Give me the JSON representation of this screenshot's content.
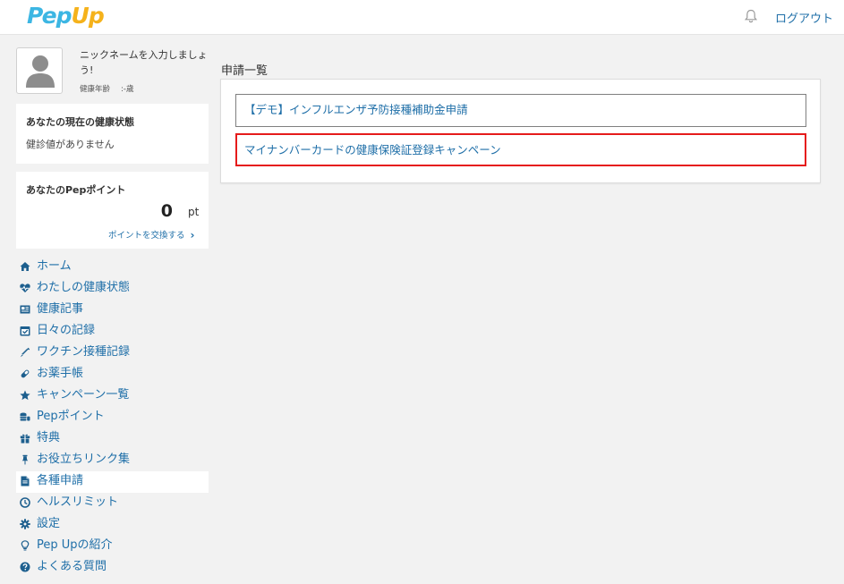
{
  "header": {
    "logo_main": "Pep",
    "logo_accent": "Up",
    "notification_icon": "bell-icon",
    "logout_label": "ログアウト"
  },
  "profile": {
    "nickname_prompt": "ニックネームを入力しましょう!",
    "health_age_label": "健康年齢",
    "health_age_value": ":-歳"
  },
  "health_status": {
    "title": "あなたの現在の健康状態",
    "text": "健診値がありません"
  },
  "points": {
    "title": "あなたのPepポイント",
    "value": "0",
    "unit": "pt",
    "exchange_label": "ポイントを交換する"
  },
  "nav": {
    "items": [
      {
        "label": "ホーム",
        "icon": "home-icon"
      },
      {
        "label": "わたしの健康状態",
        "icon": "heartbeat-icon"
      },
      {
        "label": "健康記事",
        "icon": "newspaper-icon"
      },
      {
        "label": "日々の記録",
        "icon": "calendar-icon"
      },
      {
        "label": "ワクチン接種記録",
        "icon": "syringe-icon"
      },
      {
        "label": "お薬手帳",
        "icon": "pill-icon"
      },
      {
        "label": "キャンペーン一覧",
        "icon": "star-icon"
      },
      {
        "label": "Pepポイント",
        "icon": "coins-icon"
      },
      {
        "label": "特典",
        "icon": "gift-icon"
      },
      {
        "label": "お役立ちリンク集",
        "icon": "pin-icon"
      },
      {
        "label": "各種申請",
        "icon": "document-icon"
      },
      {
        "label": "ヘルスリミット",
        "icon": "clock-icon"
      },
      {
        "label": "設定",
        "icon": "gear-icon"
      },
      {
        "label": "Pep Upの紹介",
        "icon": "lightbulb-icon"
      },
      {
        "label": "よくある質問",
        "icon": "question-icon"
      }
    ],
    "active_index": 10
  },
  "main": {
    "title": "申請一覧",
    "applications": [
      {
        "label": "【デモ】インフルエンザ予防接種補助金申請"
      },
      {
        "label": "マイナンバーカードの健康保険証登録キャンペーン"
      }
    ]
  },
  "colors": {
    "link": "#1f6fa8",
    "logo_blue": "#3cb6e3",
    "logo_yellow": "#f5b21b",
    "highlight": "#e51b1b",
    "background": "#f2f2f2"
  }
}
